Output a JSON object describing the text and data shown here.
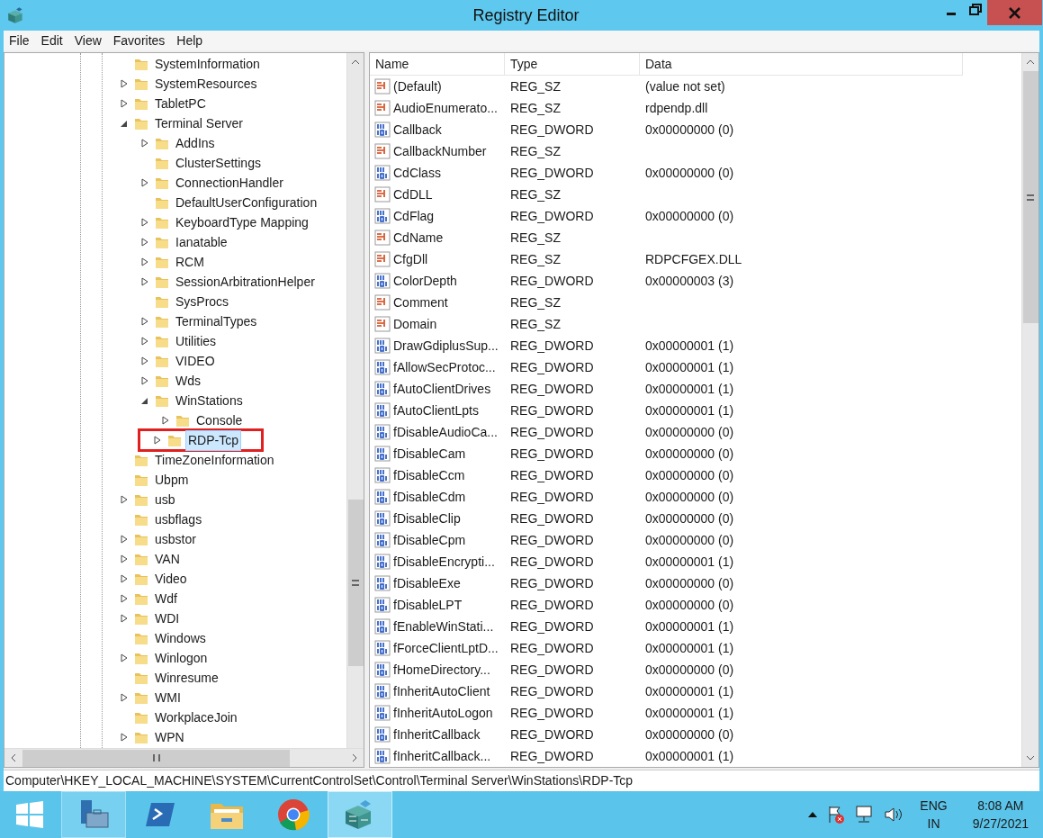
{
  "window": {
    "title": "Registry Editor"
  },
  "menu": [
    "File",
    "Edit",
    "View",
    "Favorites",
    "Help"
  ],
  "tree": [
    {
      "label": "SystemInformation",
      "kind": "leaf",
      "selected": false,
      "boxed": false
    },
    {
      "label": "SystemResources",
      "kind": "collapsed",
      "selected": false,
      "boxed": false
    },
    {
      "label": "TabletPC",
      "kind": "collapsed",
      "selected": false,
      "boxed": false
    },
    {
      "label": "Terminal Server",
      "kind": "expanded",
      "selected": false,
      "boxed": false,
      "children": [
        {
          "label": "AddIns",
          "kind": "collapsed",
          "selected": false,
          "boxed": false
        },
        {
          "label": "ClusterSettings",
          "kind": "leaf",
          "selected": false,
          "boxed": false
        },
        {
          "label": "ConnectionHandler",
          "kind": "collapsed",
          "selected": false,
          "boxed": false
        },
        {
          "label": "DefaultUserConfiguration",
          "kind": "leaf",
          "selected": false,
          "boxed": false
        },
        {
          "label": "KeyboardType Mapping",
          "kind": "collapsed",
          "selected": false,
          "boxed": false
        },
        {
          "label": "Ianatable",
          "kind": "collapsed",
          "selected": false,
          "boxed": false
        },
        {
          "label": "RCM",
          "kind": "collapsed",
          "selected": false,
          "boxed": false
        },
        {
          "label": "SessionArbitrationHelper",
          "kind": "collapsed",
          "selected": false,
          "boxed": false
        },
        {
          "label": "SysProcs",
          "kind": "leaf",
          "selected": false,
          "boxed": false
        },
        {
          "label": "TerminalTypes",
          "kind": "collapsed",
          "selected": false,
          "boxed": false
        },
        {
          "label": "Utilities",
          "kind": "collapsed",
          "selected": false,
          "boxed": false
        },
        {
          "label": "VIDEO",
          "kind": "collapsed",
          "selected": false,
          "boxed": false
        },
        {
          "label": "Wds",
          "kind": "collapsed",
          "selected": false,
          "boxed": false
        },
        {
          "label": "WinStations",
          "kind": "expanded",
          "selected": false,
          "boxed": false,
          "children": [
            {
              "label": "Console",
              "kind": "collapsed",
              "selected": false,
              "boxed": false
            },
            {
              "label": "RDP-Tcp",
              "kind": "collapsed",
              "selected": true,
              "boxed": true
            }
          ]
        }
      ]
    },
    {
      "label": "TimeZoneInformation",
      "kind": "leaf",
      "selected": false,
      "boxed": false
    },
    {
      "label": "Ubpm",
      "kind": "leaf",
      "selected": false,
      "boxed": false
    },
    {
      "label": "usb",
      "kind": "collapsed",
      "selected": false,
      "boxed": false
    },
    {
      "label": "usbflags",
      "kind": "leaf",
      "selected": false,
      "boxed": false
    },
    {
      "label": "usbstor",
      "kind": "collapsed",
      "selected": false,
      "boxed": false
    },
    {
      "label": "VAN",
      "kind": "collapsed",
      "selected": false,
      "boxed": false
    },
    {
      "label": "Video",
      "kind": "collapsed",
      "selected": false,
      "boxed": false
    },
    {
      "label": "Wdf",
      "kind": "collapsed",
      "selected": false,
      "boxed": false
    },
    {
      "label": "WDI",
      "kind": "collapsed",
      "selected": false,
      "boxed": false
    },
    {
      "label": "Windows",
      "kind": "leaf",
      "selected": false,
      "boxed": false
    },
    {
      "label": "Winlogon",
      "kind": "collapsed",
      "selected": false,
      "boxed": false
    },
    {
      "label": "Winresume",
      "kind": "leaf",
      "selected": false,
      "boxed": false
    },
    {
      "label": "WMI",
      "kind": "collapsed",
      "selected": false,
      "boxed": false
    },
    {
      "label": "WorkplaceJoin",
      "kind": "leaf",
      "selected": false,
      "boxed": false
    },
    {
      "label": "WPN",
      "kind": "collapsed",
      "selected": false,
      "boxed": false
    }
  ],
  "columns": [
    "Name",
    "Type",
    "Data"
  ],
  "values": [
    {
      "kind": "sz",
      "name": "(Default)",
      "type": "REG_SZ",
      "data": "(value not set)"
    },
    {
      "kind": "sz",
      "name": "AudioEnumerato...",
      "type": "REG_SZ",
      "data": "rdpendp.dll"
    },
    {
      "kind": "dword",
      "name": "Callback",
      "type": "REG_DWORD",
      "data": "0x00000000 (0)"
    },
    {
      "kind": "sz",
      "name": "CallbackNumber",
      "type": "REG_SZ"
    },
    {
      "kind": "dword",
      "name": "CdClass",
      "type": "REG_DWORD",
      "data": "0x00000000 (0)"
    },
    {
      "kind": "sz",
      "name": "CdDLL",
      "type": "REG_SZ"
    },
    {
      "kind": "dword",
      "name": "CdFlag",
      "type": "REG_DWORD",
      "data": "0x00000000 (0)"
    },
    {
      "kind": "sz",
      "name": "CdName",
      "type": "REG_SZ"
    },
    {
      "kind": "sz",
      "name": "CfgDll",
      "type": "REG_SZ",
      "data": "RDPCFGEX.DLL"
    },
    {
      "kind": "dword",
      "name": "ColorDepth",
      "type": "REG_DWORD",
      "data": "0x00000003 (3)"
    },
    {
      "kind": "sz",
      "name": "Comment",
      "type": "REG_SZ"
    },
    {
      "kind": "sz",
      "name": "Domain",
      "type": "REG_SZ"
    },
    {
      "kind": "dword",
      "name": "DrawGdiplusSup...",
      "type": "REG_DWORD",
      "data": "0x00000001 (1)"
    },
    {
      "kind": "dword",
      "name": "fAllowSecProtoc...",
      "type": "REG_DWORD",
      "data": "0x00000001 (1)"
    },
    {
      "kind": "dword",
      "name": "fAutoClientDrives",
      "type": "REG_DWORD",
      "data": "0x00000001 (1)"
    },
    {
      "kind": "dword",
      "name": "fAutoClientLpts",
      "type": "REG_DWORD",
      "data": "0x00000001 (1)"
    },
    {
      "kind": "dword",
      "name": "fDisableAudioCa...",
      "type": "REG_DWORD",
      "data": "0x00000000 (0)"
    },
    {
      "kind": "dword",
      "name": "fDisableCam",
      "type": "REG_DWORD",
      "data": "0x00000000 (0)"
    },
    {
      "kind": "dword",
      "name": "fDisableCcm",
      "type": "REG_DWORD",
      "data": "0x00000000 (0)"
    },
    {
      "kind": "dword",
      "name": "fDisableCdm",
      "type": "REG_DWORD",
      "data": "0x00000000 (0)"
    },
    {
      "kind": "dword",
      "name": "fDisableClip",
      "type": "REG_DWORD",
      "data": "0x00000000 (0)"
    },
    {
      "kind": "dword",
      "name": "fDisableCpm",
      "type": "REG_DWORD",
      "data": "0x00000000 (0)"
    },
    {
      "kind": "dword",
      "name": "fDisableEncrypti...",
      "type": "REG_DWORD",
      "data": "0x00000001 (1)"
    },
    {
      "kind": "dword",
      "name": "fDisableExe",
      "type": "REG_DWORD",
      "data": "0x00000000 (0)"
    },
    {
      "kind": "dword",
      "name": "fDisableLPT",
      "type": "REG_DWORD",
      "data": "0x00000000 (0)"
    },
    {
      "kind": "dword",
      "name": "fEnableWinStati...",
      "type": "REG_DWORD",
      "data": "0x00000001 (1)"
    },
    {
      "kind": "dword",
      "name": "fForceClientLptD...",
      "type": "REG_DWORD",
      "data": "0x00000001 (1)"
    },
    {
      "kind": "dword",
      "name": "fHomeDirectory...",
      "type": "REG_DWORD",
      "data": "0x00000000 (0)"
    },
    {
      "kind": "dword",
      "name": "fInheritAutoClient",
      "type": "REG_DWORD",
      "data": "0x00000001 (1)"
    },
    {
      "kind": "dword",
      "name": "fInheritAutoLogon",
      "type": "REG_DWORD",
      "data": "0x00000001 (1)"
    },
    {
      "kind": "dword",
      "name": "fInheritCallback",
      "type": "REG_DWORD",
      "data": "0x00000000 (0)"
    },
    {
      "kind": "dword",
      "name": "fInheritCallback...",
      "type": "REG_DWORD",
      "data": "0x00000001 (1)"
    }
  ],
  "status_bar": "Computer\\HKEY_LOCAL_MACHINE\\SYSTEM\\CurrentControlSet\\Control\\Terminal Server\\WinStations\\RDP-Tcp",
  "taskbar": {
    "apps": [
      {
        "kind": "server-manager",
        "selected": false
      },
      {
        "kind": "powershell",
        "selected": false
      },
      {
        "kind": "explorer",
        "selected": false
      },
      {
        "kind": "chrome",
        "selected": false
      },
      {
        "kind": "regedit",
        "selected": true
      }
    ],
    "language": "ENG",
    "region": "IN",
    "time": "8:08 AM",
    "date": "9/27/2021"
  }
}
